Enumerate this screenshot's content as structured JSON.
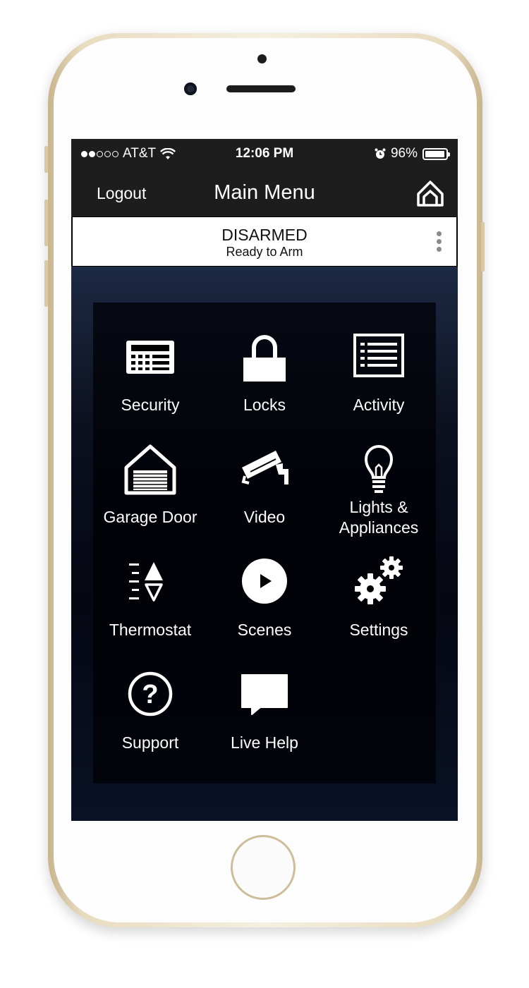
{
  "status_bar": {
    "carrier": "AT&T",
    "time": "12:06 PM",
    "battery_percent": "96%",
    "battery_level": 0.96
  },
  "nav": {
    "logout_label": "Logout",
    "title": "Main Menu",
    "home_icon": "home-icon"
  },
  "alarm": {
    "state": "DISARMED",
    "subtitle": "Ready to Arm"
  },
  "menu": {
    "items": [
      {
        "label": "Security",
        "icon": "keypad-icon"
      },
      {
        "label": "Locks",
        "icon": "lock-icon"
      },
      {
        "label": "Activity",
        "icon": "activity-list-icon"
      },
      {
        "label": "Garage Door",
        "icon": "garage-icon"
      },
      {
        "label": "Video",
        "icon": "camera-icon"
      },
      {
        "label": "Lights &",
        "label2": "Appliances",
        "icon": "lightbulb-icon"
      },
      {
        "label": "Thermostat",
        "icon": "thermostat-icon"
      },
      {
        "label": "Scenes",
        "icon": "play-icon"
      },
      {
        "label": "Settings",
        "icon": "gears-icon"
      },
      {
        "label": "Support",
        "icon": "help-icon"
      },
      {
        "label": "Live Help",
        "icon": "chat-icon"
      }
    ]
  },
  "colors": {
    "bar_background": "#1d1d1d",
    "phone_gold": "#d8c9a5"
  }
}
